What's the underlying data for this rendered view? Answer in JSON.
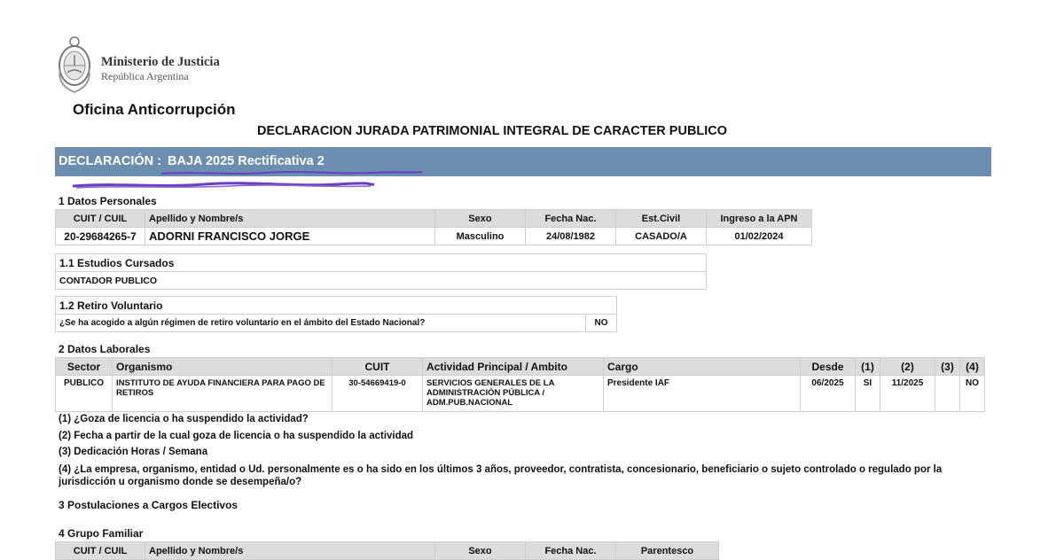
{
  "header": {
    "ministry": "Ministerio de Justicia",
    "republic": "República Argentina",
    "office": "Oficina Anticorrupción",
    "title": "DECLARACION JURADA PATRIMONIAL INTEGRAL DE CARACTER PUBLICO"
  },
  "declaration": {
    "label": "DECLARACIÓN :",
    "value": "BAJA 2025 Rectificativa 2"
  },
  "personal": {
    "section_title": "1 Datos Personales",
    "headers": [
      "CUIT / CUIL",
      "Apellido y Nombre/s",
      "Sexo",
      "Fecha Nac.",
      "Est.Civil",
      "Ingreso a la APN"
    ],
    "row": [
      "20-29684265-7",
      "ADORNI FRANCISCO JORGE",
      "Masculino",
      "24/08/1982",
      "CASADO/A",
      "01/02/2024"
    ]
  },
  "studies": {
    "section_title": "1.1 Estudios Cursados",
    "value": "CONTADOR PUBLICO"
  },
  "retirement": {
    "section_title": "1.2 Retiro Voluntario",
    "question": "¿Se ha acogido a algún régimen de retiro voluntario en el ámbito del Estado Nacional?",
    "answer": "NO"
  },
  "work": {
    "section_title": "2 Datos Laborales",
    "headers": [
      "Sector",
      "Organismo",
      "CUIT",
      "Actividad Principal / Ambito",
      "Cargo",
      "Desde",
      "(1)",
      "(2)",
      "(3)",
      "(4)"
    ],
    "row": [
      "PUBLICO",
      "INSTITUTO DE AYUDA FINANCIERA PARA PAGO DE RETIROS",
      "30-54669419-0",
      "SERVICIOS GENERALES DE LA ADMINISTRACIÓN PÚBLICA / ADM.PUB.NACIONAL",
      "Presidente IAF",
      "06/2025",
      "SI",
      "11/2025",
      "",
      "NO"
    ]
  },
  "notes": [
    "(1) ¿Goza de licencia o ha suspendido la actividad?",
    "(2) Fecha a partir de la cual goza de licencia o ha suspendido la actividad",
    "(3) Dedicación Horas / Semana",
    "(4) ¿La empresa, organismo, entidad o Ud. personalmente es o ha sido en los últimos 3 años, proveedor, contratista, concesionario, beneficiario o sujeto controlado o regulado por la jurisdicción u organismo donde se desempeña/o?"
  ],
  "elective": {
    "section_title": "3 Postulaciones a Cargos Electivos"
  },
  "family": {
    "section_title": "4 Grupo Familiar",
    "headers": [
      "CUIT / CUIL",
      "Apellido y Nombre/s",
      "Sexo",
      "Fecha Nac.",
      "Parentesco"
    ]
  },
  "colors": {
    "band": "#6b8db0",
    "header_cell": "#dcdcdc",
    "scribble": "#6a3fc4"
  }
}
